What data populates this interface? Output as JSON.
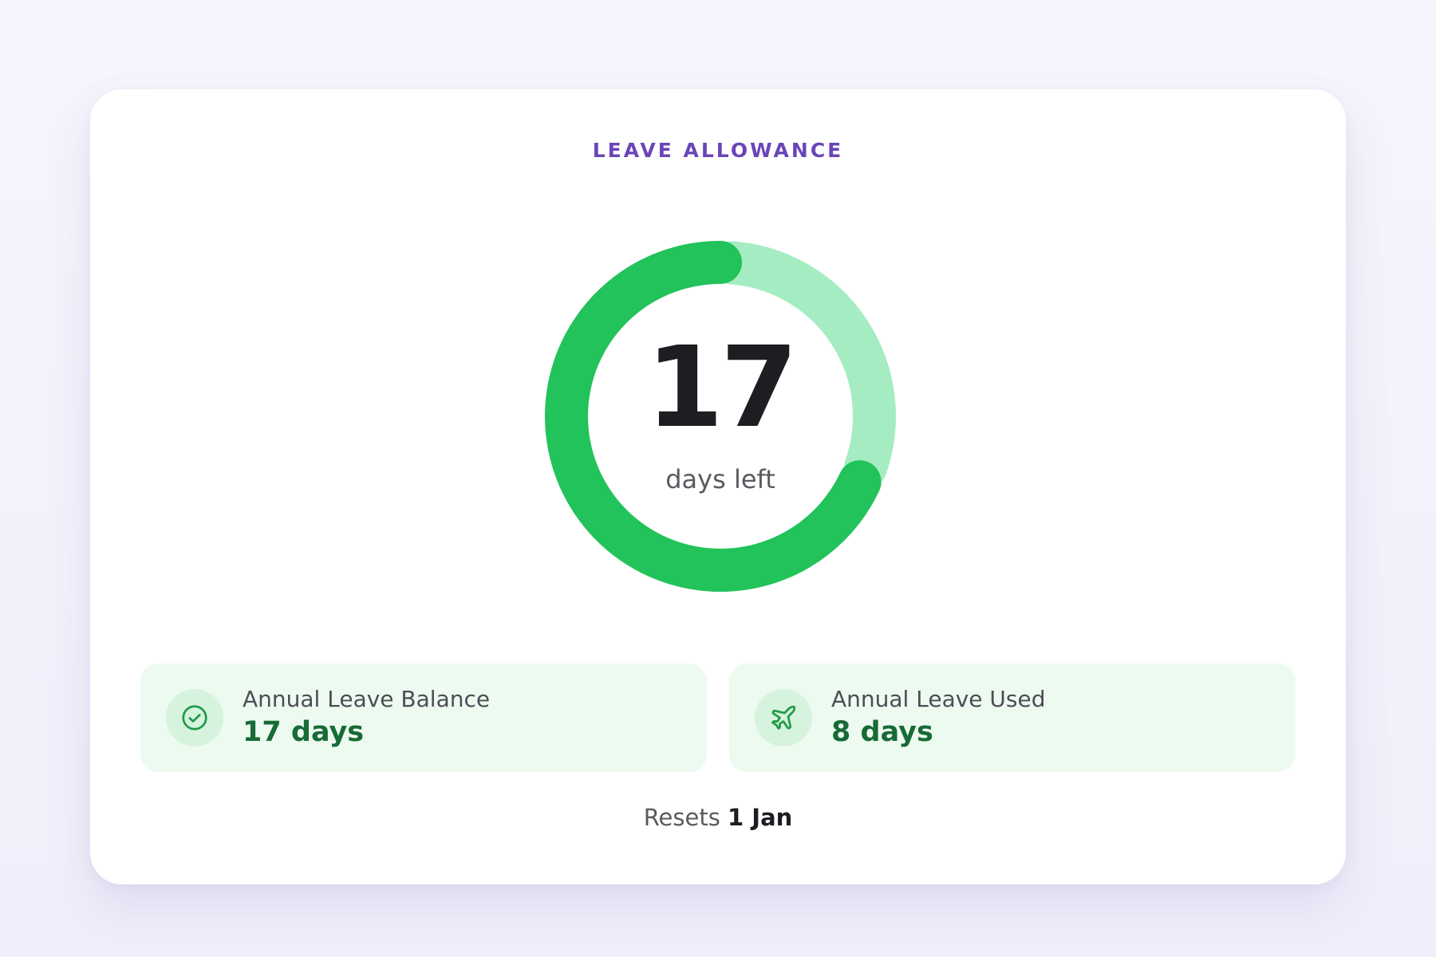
{
  "card": {
    "title": "LEAVE ALLOWANCE"
  },
  "ring": {
    "number": "17",
    "caption": "days left",
    "remaining_days": 17,
    "used_days": 8,
    "colors": {
      "remaining": "#22c35a",
      "used": "#a6ecc2"
    }
  },
  "stats": {
    "balance": {
      "icon": "check-circle-icon",
      "label": "Annual Leave Balance",
      "value": "17 days"
    },
    "used": {
      "icon": "airplane-icon",
      "label": "Annual Leave Used",
      "value": "8 days"
    }
  },
  "footer": {
    "prefix": "Resets",
    "date": "1 Jan"
  },
  "colors": {
    "accent": "#6b45b8",
    "stat_value": "#176b35",
    "stat_background": "#edfaf0"
  }
}
